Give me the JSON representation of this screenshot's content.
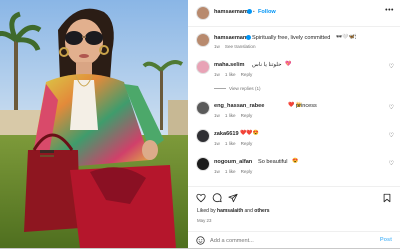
{
  "post": {
    "username": "hamsaemam",
    "follow_label": "Follow",
    "bullet": "•"
  },
  "caption": {
    "username": "hamsaemam",
    "text": "Spiritually free, lively committed",
    "emoji": "🕶🤍🦋🕯",
    "time": "1w",
    "see_translation": "See translation"
  },
  "comments": [
    {
      "username": "maha.selim",
      "text": "حلوتنا يا ناس",
      "emoji": "💖",
      "time": "1w",
      "likes": "1 like",
      "reply": "Reply"
    },
    {
      "username": "eng_hassan_rabee",
      "text": "princess",
      "emoji": "❤️ 👑",
      "time": "1w",
      "likes": "1 like",
      "reply": "Reply"
    },
    {
      "username": "zaka6619",
      "text": "",
      "emoji": "❤️❤️😍",
      "time": "1w",
      "likes": "1 like",
      "reply": "Reply"
    },
    {
      "username": "nogoum_alfan",
      "text": "So beautiful",
      "emoji": "😍",
      "time": "1w",
      "likes": "1 like",
      "reply": "Reply"
    }
  ],
  "view_replies": "View replies (1)",
  "likes": {
    "prefix": "Liked by",
    "user": "hamsalaith",
    "suffix": "and",
    "others": "others"
  },
  "date": "May 23",
  "add_comment": {
    "placeholder": "Add a comment...",
    "post_label": "Post"
  },
  "colors": {
    "accent": "#0095f6",
    "text": "#262626",
    "muted": "#737373",
    "border": "#efefef"
  }
}
